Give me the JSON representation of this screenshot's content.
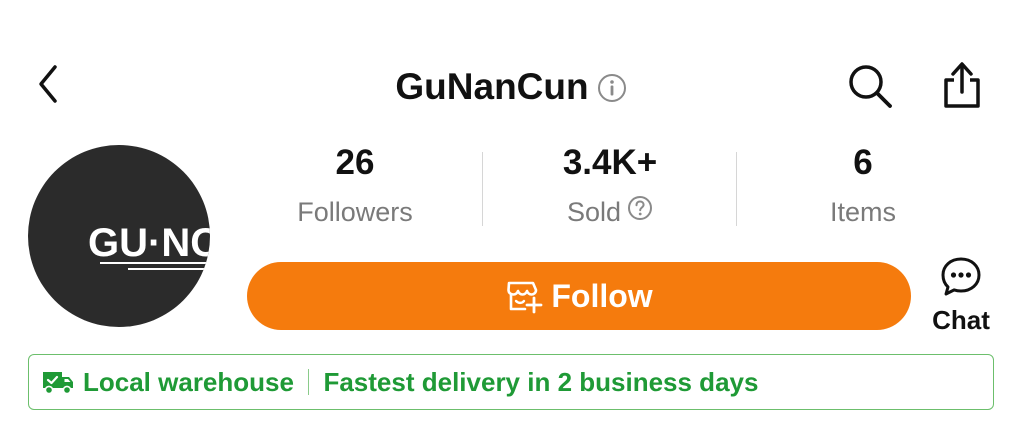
{
  "header": {
    "title": "GuNanCun"
  },
  "avatar": {
    "logo_text": "GU·NC"
  },
  "stats": [
    {
      "value": "26",
      "label": "Followers"
    },
    {
      "value": "3.4K+",
      "label": "Sold"
    },
    {
      "value": "6",
      "label": "Items"
    }
  ],
  "actions": {
    "follow_label": "Follow",
    "chat_label": "Chat"
  },
  "banner": {
    "warehouse_label": "Local warehouse",
    "delivery_text": "Fastest delivery in 2 business days"
  },
  "icons": {
    "back": "chevron-left-icon",
    "info": "info-icon",
    "search": "search-icon",
    "share": "share-icon",
    "sold_help": "question-icon",
    "follow": "store-add-icon",
    "chat": "chat-bubble-icon",
    "truck": "truck-icon"
  },
  "colors": {
    "accent": "#f57b0d",
    "banner_green": "#1f9a36",
    "banner_border": "#6cbf6c",
    "avatar_bg": "#2b2b2b",
    "muted_text": "#7a7a7a"
  }
}
